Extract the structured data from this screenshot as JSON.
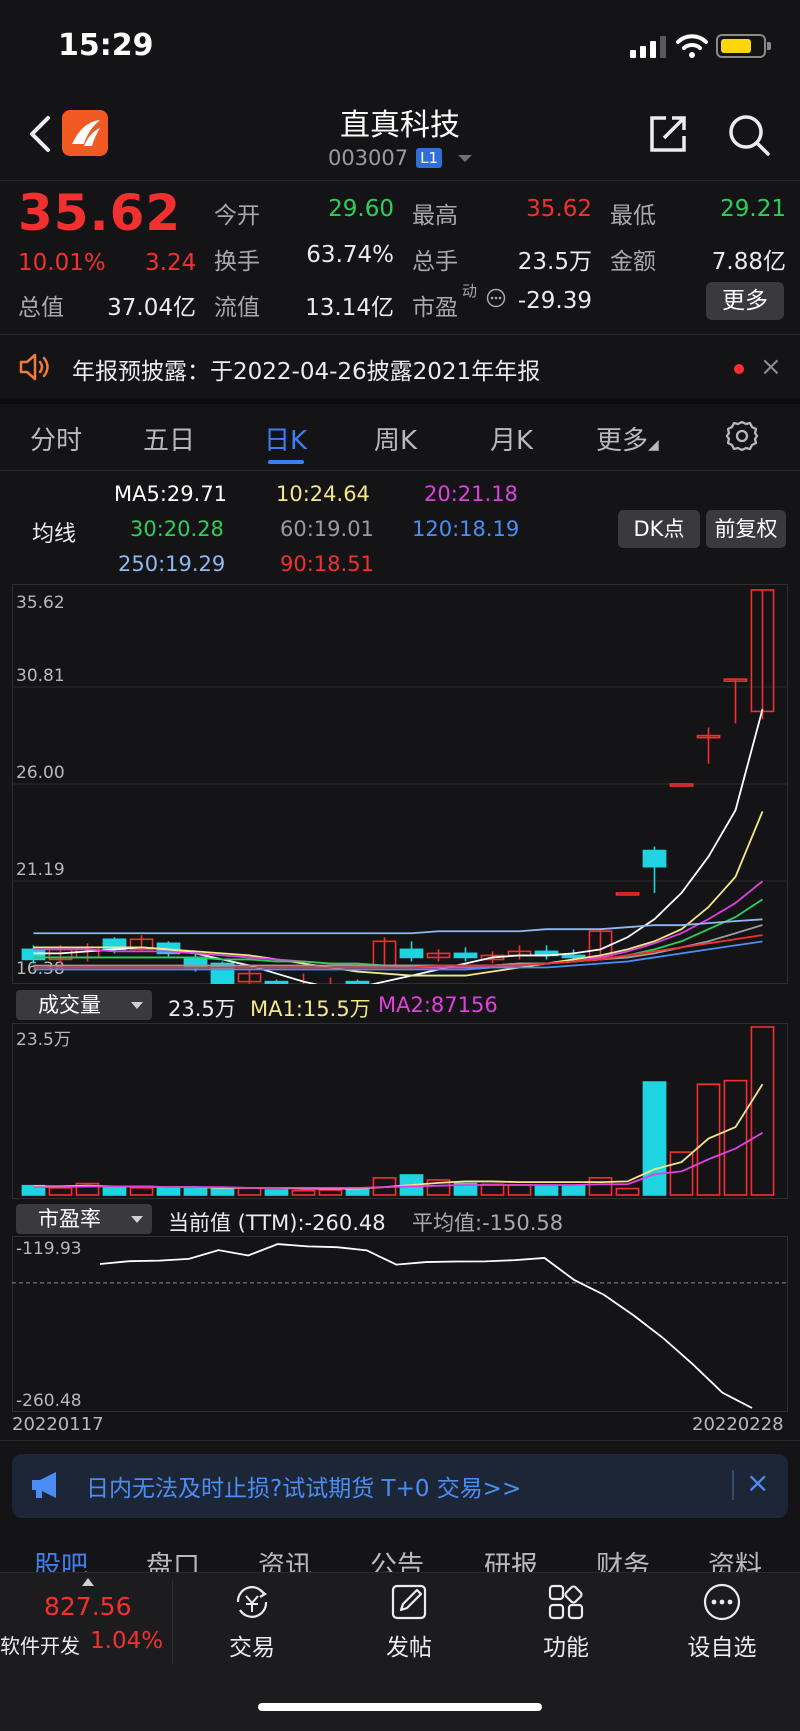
{
  "status_bar": {
    "time": "15:29"
  },
  "header": {
    "name": "直真科技",
    "code": "003007",
    "level": "L1"
  },
  "quote": {
    "price": "35.62",
    "change_pct": "10.01%",
    "change": "3.24",
    "open_label": "今开",
    "open": "29.60",
    "high_label": "最高",
    "high": "35.62",
    "low_label": "最低",
    "low": "29.21",
    "turnover_label": "换手",
    "turnover": "63.74%",
    "volume_label": "总手",
    "volume": "23.5万",
    "amount_label": "金额",
    "amount": "7.88亿",
    "mktcap_label": "总值",
    "mktcap": "37.04亿",
    "float_label": "流值",
    "float_cap": "13.14亿",
    "pe_label": "市盈",
    "pe_sup": "动",
    "pe": "-29.39",
    "more_label": "更多"
  },
  "notice": {
    "text": "年报预披露：于2022-04-26披露2021年年报",
    "close": "×"
  },
  "period_tabs": [
    "分时",
    "五日",
    "日K",
    "周K",
    "月K",
    "更多"
  ],
  "active_period": "日K",
  "ma_legend": {
    "label": "均线",
    "items": [
      {
        "text": "MA5:29.71",
        "color": "#ffffff"
      },
      {
        "text": "10:24.64",
        "color": "#f5e68a"
      },
      {
        "text": "20:21.18",
        "color": "#e040e0"
      },
      {
        "text": "30:20.28",
        "color": "#2ad05a"
      },
      {
        "text": "60:19.01",
        "color": "#9a9aa0"
      },
      {
        "text": "120:18.19",
        "color": "#4a8ef5"
      },
      {
        "text": "250:19.29",
        "color": "#8fb8f5"
      },
      {
        "text": "90:18.51",
        "color": "#f23030"
      }
    ],
    "dk_btn": "DK点",
    "fq_btn": "前复权"
  },
  "chart_data": [
    {
      "type": "candlestick",
      "y_ticks": [
        "35.62",
        "30.81",
        "26.00",
        "21.19",
        "16.38"
      ],
      "ylim": [
        16.38,
        35.62
      ],
      "candles": [
        {
          "o": 17.8,
          "c": 17.3,
          "h": 18.0,
          "l": 17.1
        },
        {
          "o": 17.3,
          "c": 17.8,
          "h": 18.0,
          "l": 17.1
        },
        {
          "o": 17.4,
          "c": 17.9,
          "h": 18.1,
          "l": 17.2
        },
        {
          "o": 18.3,
          "c": 17.8,
          "h": 18.4,
          "l": 17.6
        },
        {
          "o": 17.8,
          "c": 18.3,
          "h": 18.5,
          "l": 17.7
        },
        {
          "o": 18.1,
          "c": 17.6,
          "h": 18.2,
          "l": 17.4
        },
        {
          "o": 17.4,
          "c": 16.9,
          "h": 17.6,
          "l": 16.7
        },
        {
          "o": 17.1,
          "c": 16.1,
          "h": 17.2,
          "l": 15.9
        },
        {
          "o": 16.2,
          "c": 16.6,
          "h": 16.8,
          "l": 16.0
        },
        {
          "o": 16.2,
          "c": 15.4,
          "h": 16.3,
          "l": 15.2
        },
        {
          "o": 15.5,
          "c": 15.7,
          "h": 16.6,
          "l": 15.3
        },
        {
          "o": 16.0,
          "c": 16.0,
          "h": 16.4,
          "l": 15.8
        },
        {
          "o": 16.2,
          "c": 15.9,
          "h": 16.3,
          "l": 15.7
        },
        {
          "o": 17.0,
          "c": 18.2,
          "h": 18.4,
          "l": 16.9
        },
        {
          "o": 17.8,
          "c": 17.4,
          "h": 18.2,
          "l": 17.2
        },
        {
          "o": 17.4,
          "c": 17.6,
          "h": 17.8,
          "l": 17.2
        },
        {
          "o": 17.6,
          "c": 17.4,
          "h": 17.9,
          "l": 17.2
        },
        {
          "o": 17.3,
          "c": 17.5,
          "h": 17.7,
          "l": 17.1
        },
        {
          "o": 17.5,
          "c": 17.7,
          "h": 18.0,
          "l": 17.3
        },
        {
          "o": 17.7,
          "c": 17.5,
          "h": 18.0,
          "l": 17.3
        },
        {
          "o": 17.5,
          "c": 17.4,
          "h": 17.8,
          "l": 17.2
        },
        {
          "o": 17.4,
          "c": 18.7,
          "h": 18.8,
          "l": 17.3
        },
        {
          "o": 20.6,
          "c": 20.6,
          "h": 20.6,
          "l": 20.6
        },
        {
          "o": 22.7,
          "c": 21.9,
          "h": 22.9,
          "l": 20.6
        },
        {
          "o": 26.0,
          "c": 26.0,
          "h": 26.0,
          "l": 26.0
        },
        {
          "o": 28.4,
          "c": 28.4,
          "h": 28.8,
          "l": 27.0
        },
        {
          "o": 31.2,
          "c": 31.2,
          "h": 31.2,
          "l": 29.0
        },
        {
          "o": 29.6,
          "c": 35.62,
          "h": 35.62,
          "l": 29.21
        }
      ],
      "ma_series": [
        {
          "name": "MA5",
          "color": "#ffffff",
          "values": [
            17.6,
            17.6,
            17.7,
            17.8,
            17.9,
            17.8,
            17.6,
            17.3,
            17.0,
            16.6,
            16.2,
            15.9,
            15.9,
            16.2,
            16.5,
            16.8,
            17.1,
            17.4,
            17.5,
            17.5,
            17.6,
            17.8,
            18.4,
            19.3,
            20.6,
            22.4,
            24.7,
            29.71
          ]
        },
        {
          "name": "MA10",
          "color": "#f5e68a",
          "values": [
            17.9,
            17.9,
            17.9,
            17.9,
            17.9,
            17.8,
            17.7,
            17.6,
            17.5,
            17.3,
            17.1,
            16.9,
            16.7,
            16.6,
            16.5,
            16.5,
            16.5,
            16.7,
            16.9,
            17.1,
            17.3,
            17.5,
            17.8,
            18.2,
            18.8,
            19.9,
            21.4,
            24.64
          ]
        },
        {
          "name": "MA20",
          "color": "#e040e0",
          "values": [
            17.8,
            17.8,
            17.8,
            17.7,
            17.7,
            17.7,
            17.6,
            17.5,
            17.4,
            17.3,
            17.2,
            17.1,
            17.0,
            17.0,
            16.9,
            16.9,
            16.9,
            16.9,
            17.0,
            17.1,
            17.2,
            17.4,
            17.7,
            18.1,
            18.6,
            19.3,
            20.1,
            21.18
          ]
        },
        {
          "name": "MA30",
          "color": "#2ad05a",
          "values": [
            17.4,
            17.4,
            17.4,
            17.4,
            17.4,
            17.4,
            17.4,
            17.3,
            17.3,
            17.2,
            17.2,
            17.1,
            17.1,
            17.0,
            17.0,
            17.0,
            17.0,
            17.0,
            17.1,
            17.1,
            17.2,
            17.3,
            17.5,
            17.8,
            18.2,
            18.8,
            19.4,
            20.28
          ]
        },
        {
          "name": "MA60",
          "color": "#9a9aa0",
          "values": [
            17.0,
            17.0,
            17.0,
            17.0,
            17.0,
            17.0,
            17.0,
            17.0,
            17.0,
            17.0,
            17.0,
            17.0,
            17.0,
            17.0,
            17.0,
            17.0,
            17.0,
            17.0,
            17.1,
            17.1,
            17.2,
            17.3,
            17.4,
            17.6,
            17.9,
            18.2,
            18.6,
            19.01
          ]
        },
        {
          "name": "MA120",
          "color": "#4a8ef5",
          "values": [
            16.8,
            16.8,
            16.8,
            16.8,
            16.8,
            16.8,
            16.8,
            16.8,
            16.8,
            16.8,
            16.8,
            16.8,
            16.8,
            16.8,
            16.8,
            16.8,
            16.8,
            16.9,
            16.9,
            16.9,
            17.0,
            17.1,
            17.2,
            17.4,
            17.6,
            17.8,
            18.0,
            18.19
          ]
        },
        {
          "name": "MA250",
          "color": "#8fb8f5",
          "values": [
            18.6,
            18.6,
            18.6,
            18.6,
            18.6,
            18.6,
            18.6,
            18.6,
            18.6,
            18.6,
            18.6,
            18.6,
            18.6,
            18.6,
            18.6,
            18.7,
            18.7,
            18.7,
            18.7,
            18.8,
            18.8,
            18.8,
            18.9,
            19.0,
            19.0,
            19.1,
            19.2,
            19.29
          ]
        },
        {
          "name": "MA90",
          "color": "#f23030",
          "values": [
            16.9,
            16.9,
            16.9,
            16.9,
            16.9,
            16.9,
            16.9,
            16.9,
            16.9,
            16.9,
            16.9,
            16.9,
            16.9,
            16.9,
            16.9,
            17.0,
            17.0,
            17.0,
            17.0,
            17.1,
            17.2,
            17.3,
            17.5,
            17.7,
            17.9,
            18.1,
            18.3,
            18.51
          ]
        }
      ]
    },
    {
      "type": "bar",
      "selector_label": "成交量",
      "value_label": "23.5万",
      "ma1_label": "MA1:15.5万",
      "ma2_label": "MA2:87156",
      "y_ticks": [
        "23.5万"
      ],
      "ylim": [
        0,
        23.5
      ],
      "values": [
        1.3,
        1.0,
        1.6,
        1.0,
        1.0,
        1.0,
        1.1,
        0.9,
        1.0,
        0.7,
        0.6,
        0.7,
        0.9,
        2.4,
        2.8,
        2.1,
        1.6,
        1.5,
        1.4,
        1.3,
        1.3,
        2.4,
        0.9,
        15.8,
        6.0,
        15.5,
        16.0,
        23.5
      ],
      "ma1": [
        1.2,
        1.2,
        1.3,
        1.2,
        1.2,
        1.1,
        1.1,
        1.0,
        1.0,
        1.0,
        0.9,
        0.9,
        0.9,
        1.1,
        1.4,
        1.7,
        1.9,
        1.9,
        1.8,
        1.8,
        1.8,
        1.8,
        1.9,
        3.6,
        4.6,
        7.9,
        9.5,
        15.5
      ],
      "ma2": [
        1.1,
        1.1,
        1.2,
        1.2,
        1.2,
        1.1,
        1.1,
        1.1,
        1.0,
        1.0,
        1.0,
        1.0,
        1.0,
        1.1,
        1.2,
        1.3,
        1.4,
        1.4,
        1.4,
        1.4,
        1.4,
        1.5,
        1.5,
        2.9,
        3.3,
        5.0,
        6.5,
        8.7
      ]
    },
    {
      "type": "line",
      "selector_label": "市盈率",
      "current_label": "当前值 (TTM):-260.48",
      "avg_label": "平均值:-150.58",
      "y_ticks": [
        "-119.93",
        "-260.48"
      ],
      "ylim": [
        -260.48,
        -119.93
      ],
      "avg_value": -150.58,
      "x_labels": [
        "20220117",
        "20220228"
      ],
      "values": [
        -134.0,
        -131.5,
        -131.0,
        -129.5,
        -121.8,
        -126.5,
        -116.5,
        -118.5,
        -119.2,
        -122.0,
        -134.5,
        -132.3,
        -131.8,
        -131.7,
        -130.6,
        -128.7,
        -148.0,
        -161.0,
        -179.0,
        -199.0,
        -222.0,
        -247.0,
        -260.48
      ]
    }
  ],
  "promo": {
    "text": "日内无法及时止损?试试期货 T+0 交易>>",
    "close": "×"
  },
  "content_tabs": [
    "股吧",
    "盘口",
    "资讯",
    "公告",
    "研报",
    "财务",
    "资料"
  ],
  "bottom_bar": {
    "sector_value": "827.56",
    "sector_name": "软件开发",
    "sector_pct": "1.04%",
    "trade": "交易",
    "post": "发帖",
    "function": "功能",
    "watchlist": "设自选"
  },
  "colors": {
    "up": "#f23030",
    "down": "#1ed4e0",
    "accent": "#3d7ef0",
    "green": "#2ad05a"
  }
}
